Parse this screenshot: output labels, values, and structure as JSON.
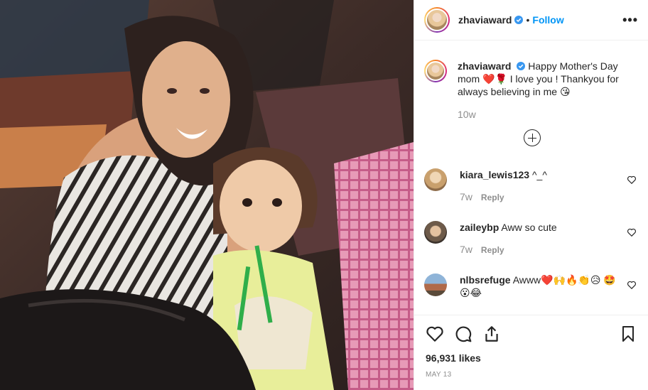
{
  "post": {
    "username": "zhaviaward",
    "follow_label": "Follow",
    "separator": "•",
    "more": "•••"
  },
  "caption": {
    "username": "zhaviaward",
    "text_part1": "Happy Mother's Day mom",
    "emoji_hearts": "❤️🌹",
    "text_part2": "I love you ! Thankyou for always believing in me",
    "emoji_end": "😘",
    "time": "10w"
  },
  "comments": [
    {
      "username": "kiara_lewis123",
      "text": "^_^",
      "time": "7w",
      "reply_label": "Reply"
    },
    {
      "username": "zaileybp",
      "text": "Aww so cute",
      "time": "7w",
      "reply_label": "Reply"
    },
    {
      "username": "nlbsrefuge",
      "text": "Awww❤️🙌🔥👏😥 🤩😮😂"
    }
  ],
  "likes": "96,931 likes",
  "date": "MAY 13",
  "colors": {
    "accent": "#0095f6",
    "verified": "#3897f0",
    "text": "#262626",
    "muted": "#8e8e8e",
    "heart": "#e0245e"
  }
}
